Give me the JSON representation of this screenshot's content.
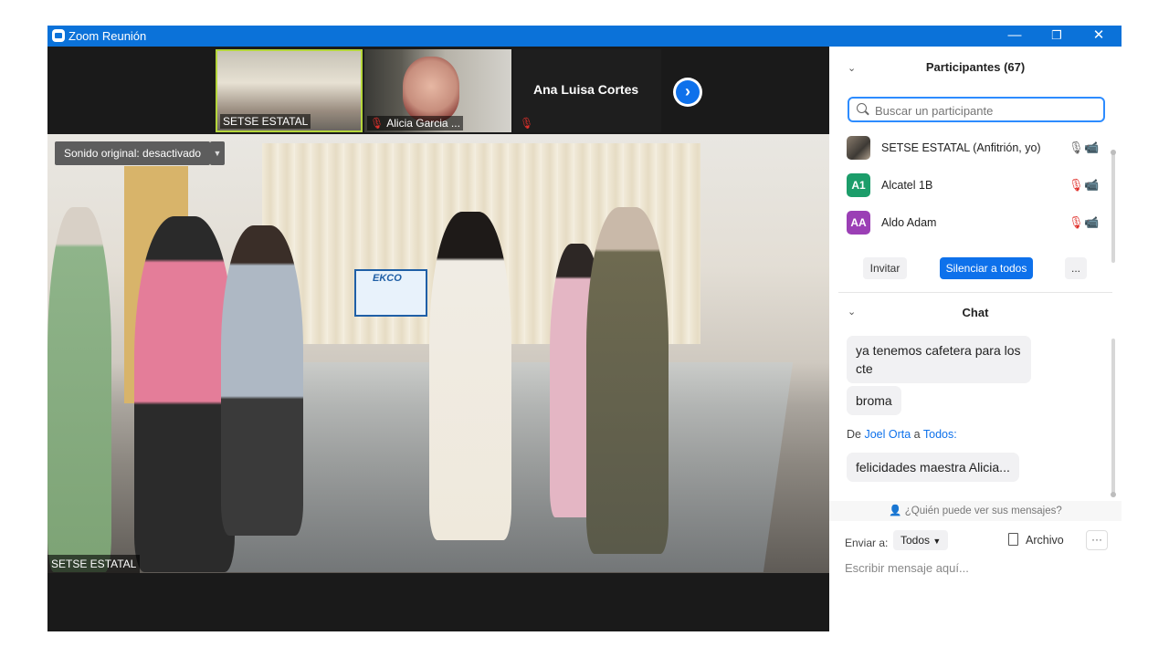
{
  "window": {
    "title": "Zoom Reunión",
    "controls": {
      "minimize": "—",
      "restore": "❐",
      "close": "✕"
    }
  },
  "video": {
    "thumbnails": [
      {
        "label": "SETSE ESTATAL",
        "muted": false
      },
      {
        "label": "Alicia Garcia ...",
        "muted": true
      },
      {
        "label": "Ana Luisa Cortes",
        "muted": true
      }
    ],
    "next_arrow": "›",
    "sound_button": "Sonido original: desactivado",
    "sound_menu_arrow": "▼",
    "main_label": "SETSE ESTATAL",
    "main_badge": "EKCO"
  },
  "participants": {
    "title": "Participantes (67)",
    "search_placeholder": "Buscar un participante",
    "list": [
      {
        "initials": "",
        "name": "SETSE ESTATAL (Anfitrión, yo)",
        "mic": "🎙",
        "cam": "📹"
      },
      {
        "initials": "A1",
        "name": "Alcatel 1B",
        "mic": "🎙",
        "cam": "📹"
      },
      {
        "initials": "AA",
        "name": "Aldo Adam",
        "mic": "🎙",
        "cam": "📹"
      }
    ],
    "invite_label": "Invitar",
    "mute_all_label": "Silenciar a todos",
    "more_label": "..."
  },
  "chat": {
    "title": "Chat",
    "messages": [
      {
        "text": "ya tenemos cafetera para los cte"
      },
      {
        "text": "broma"
      }
    ],
    "from_prefix": "De",
    "from_name": "Joel Orta",
    "from_middle": "a",
    "from_to": "Todos:",
    "last_message": "felicidades maestra Alicia...",
    "who_can_see": "¿Quién puede ver sus mensajes?",
    "send_to_label": "Enviar a:",
    "send_to_value": "Todos",
    "file_label": "Archivo",
    "more_label": "···",
    "compose_placeholder": "Escribir mensaje aquí..."
  },
  "colors": {
    "titlebar": "#0b72d9",
    "accent": "#0e71eb",
    "muted_red": "#e0302b",
    "active_speaker": "#b5d63b"
  }
}
